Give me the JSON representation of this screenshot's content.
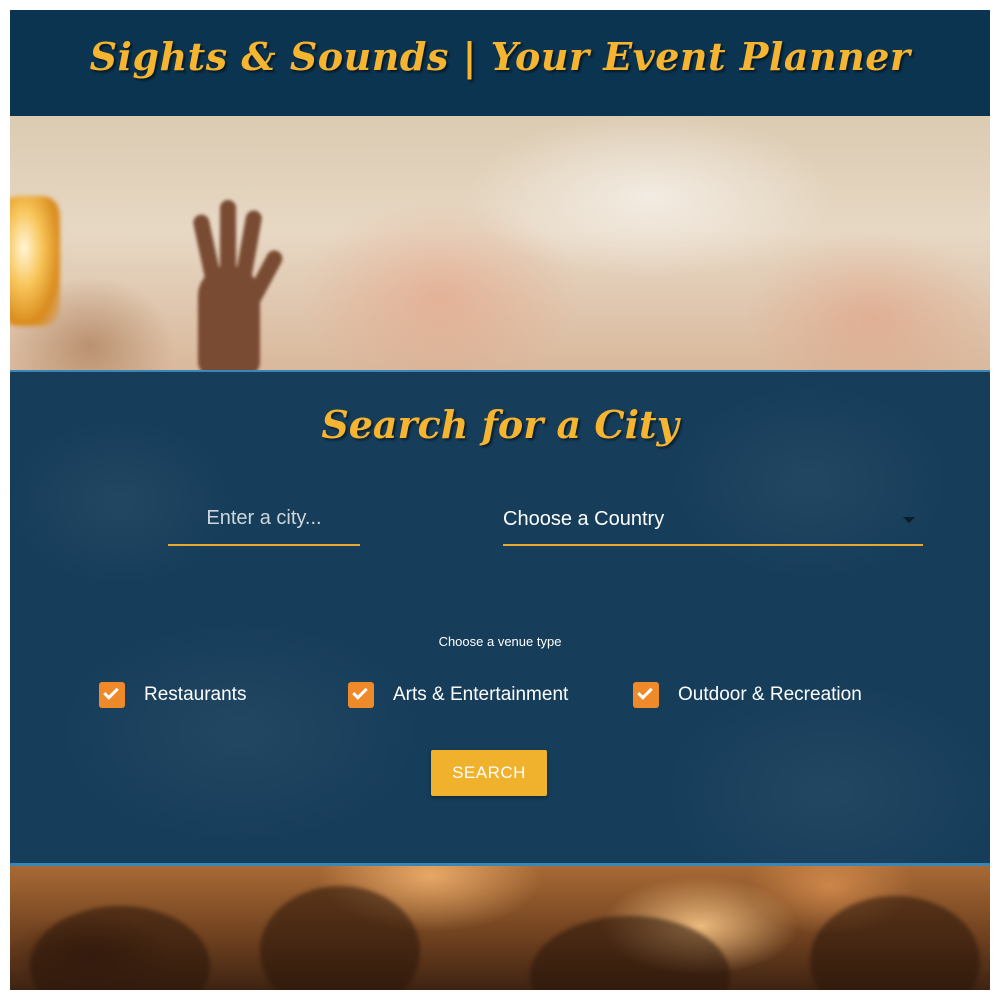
{
  "header": {
    "title": "Sights & Sounds | Your Event Planner"
  },
  "search": {
    "heading": "Search for a City",
    "city_placeholder": "Enter a city...",
    "country_select": {
      "selected": "Choose a Country"
    },
    "venue_type_label": "Choose a venue type",
    "venue_types": [
      {
        "label": "Restaurants",
        "checked": true
      },
      {
        "label": "Arts & Entertainment",
        "checked": true
      },
      {
        "label": "Outdoor & Recreation",
        "checked": true
      }
    ],
    "button_label": "SEARCH"
  },
  "colors": {
    "header_bg": "#0b3450",
    "panel_bg": "#163d5a",
    "accent_gold": "#f6b531",
    "checkbox_orange": "#ef8a2a",
    "panel_border": "#3a86b6"
  },
  "icons": {
    "checkbox": "check-icon",
    "dropdown": "caret-down-icon"
  }
}
